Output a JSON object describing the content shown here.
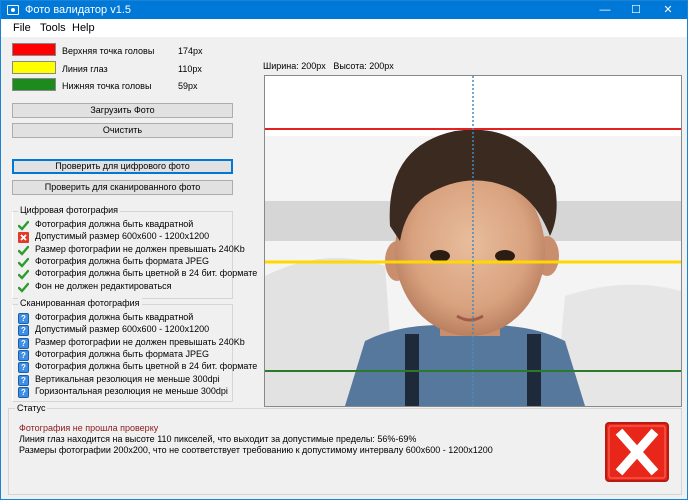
{
  "window": {
    "title": "Фото валидатор v1.5"
  },
  "menu": [
    "File",
    "Tools",
    "Help"
  ],
  "lines": [
    {
      "label": "Верхняя точка головы",
      "value": "174px",
      "color": "#ff0000"
    },
    {
      "label": "Линия глаз",
      "value": "110px",
      "color": "#ffff00"
    },
    {
      "label": "Нижняя точка головы",
      "value": "59px",
      "color": "#1d8a1d"
    }
  ],
  "buttons": {
    "load": "Загрузить Фото",
    "clear": "Очистить",
    "check_digital": "Проверить для цифрового фото",
    "check_scanned": "Проверить для сканированного фото"
  },
  "digital": {
    "title": "Цифровая фотография",
    "items": [
      {
        "text": "Фотография должна быть квадратной",
        "status": "ok"
      },
      {
        "text": "Допустимый размер 600x600 - 1200x1200",
        "status": "fail"
      },
      {
        "text": "Размер фотографии не должен превышать 240Kb",
        "status": "ok"
      },
      {
        "text": "Фотография должна быть формата JPEG",
        "status": "ok"
      },
      {
        "text": "Фотография должна быть цветной в 24 бит. формате",
        "status": "ok"
      },
      {
        "text": "Фон не должен редактироваться",
        "status": "ok"
      }
    ]
  },
  "scanned": {
    "title": "Сканированная фотография",
    "items": [
      {
        "text": "Фотография должна быть квадратной",
        "status": "unknown"
      },
      {
        "text": "Допустимый размер 600x600 - 1200x1200",
        "status": "unknown"
      },
      {
        "text": "Размер фотографии не должен превышать 240Kb",
        "status": "unknown"
      },
      {
        "text": "Фотография должна быть формата JPEG",
        "status": "unknown"
      },
      {
        "text": "Фотография должна быть цветной в 24 бит. формате",
        "status": "unknown"
      },
      {
        "text": "Вертикальная резолюция не меньше 300dpi",
        "status": "unknown"
      },
      {
        "text": "Горизонтальная резолюция не меньше 300dpi",
        "status": "unknown"
      }
    ]
  },
  "photo": {
    "width_label": "Ширина: 200px",
    "height_label": "Высота: 200px"
  },
  "status": {
    "title": "Статус",
    "headline": "Фотография не прошла проверку",
    "lines": [
      "Линия глаз находится на высоте 110 пикселей, что выходит за допустимые пределы: 56%-69%",
      "Размеры фотографии 200x200, что не соответствует требованию к допустимому интервалу 600x600 - 1200x1200"
    ]
  },
  "colors": {
    "titlebar": "#0078d7",
    "status_headline": "#8b1a1a",
    "error": "#e8261a"
  }
}
